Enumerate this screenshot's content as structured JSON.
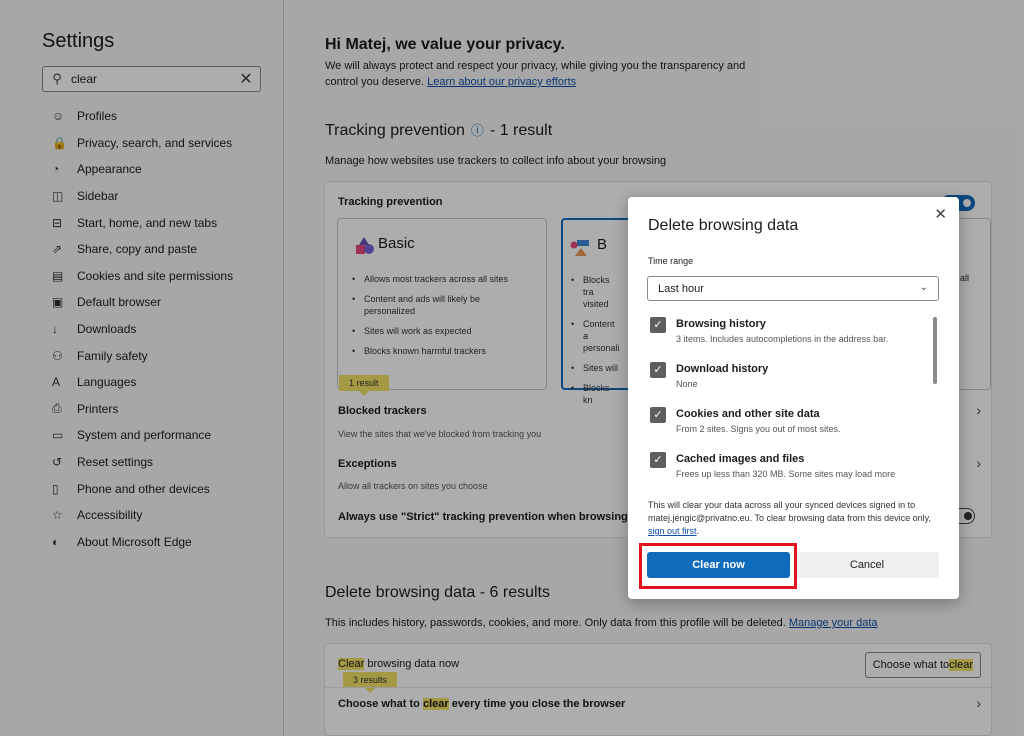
{
  "sidebar": {
    "title": "Settings",
    "search_value": "clear",
    "items": [
      {
        "label": "Profiles",
        "icon": "profile-icon",
        "glyph": "☺"
      },
      {
        "label": "Privacy, search, and services",
        "icon": "lock-icon",
        "glyph": "🔒"
      },
      {
        "label": "Appearance",
        "icon": "palette-icon",
        "glyph": "◔"
      },
      {
        "label": "Sidebar",
        "icon": "sidebar-icon",
        "glyph": "◫"
      },
      {
        "label": "Start, home, and new tabs",
        "icon": "home-tabs-icon",
        "glyph": "⊟"
      },
      {
        "label": "Share, copy and paste",
        "icon": "share-icon",
        "glyph": "⇗"
      },
      {
        "label": "Cookies and site permissions",
        "icon": "cookies-icon",
        "glyph": "▤"
      },
      {
        "label": "Default browser",
        "icon": "browser-icon",
        "glyph": "▣"
      },
      {
        "label": "Downloads",
        "icon": "download-icon",
        "glyph": "↓"
      },
      {
        "label": "Family safety",
        "icon": "family-icon",
        "glyph": "⚇"
      },
      {
        "label": "Languages",
        "icon": "languages-icon",
        "glyph": "A"
      },
      {
        "label": "Printers",
        "icon": "printer-icon",
        "glyph": "⎙"
      },
      {
        "label": "System and performance",
        "icon": "system-icon",
        "glyph": "▭"
      },
      {
        "label": "Reset settings",
        "icon": "reset-icon",
        "glyph": "↺"
      },
      {
        "label": "Phone and other devices",
        "icon": "phone-icon",
        "glyph": "▯"
      },
      {
        "label": "Accessibility",
        "icon": "accessibility-icon",
        "glyph": "☆"
      },
      {
        "label": "About Microsoft Edge",
        "icon": "edge-icon",
        "glyph": "◐"
      }
    ]
  },
  "privacy": {
    "title": "Hi Matej, we value your privacy.",
    "text": "We will always protect and respect your privacy, while giving you the transparency and control you deserve.",
    "link": "Learn about our privacy efforts"
  },
  "tracking": {
    "title": "Tracking prevention",
    "result": "- 1 result",
    "subtitle": "Manage how websites use trackers to collect info about your browsing",
    "label": "Tracking prevention",
    "basic": {
      "title": "Basic",
      "bullets": [
        "Allows most trackers across all sites",
        "Content and ads will likely be personalized",
        "Sites will work as expected",
        "Blocks known harmful trackers"
      ]
    },
    "balanced": {
      "title": "B",
      "small": "(",
      "bullets": [
        "Blocks tra visited",
        "Content a personali",
        "Sites will",
        "Blocks kn"
      ]
    },
    "strict_fragment": "all",
    "badge": "1 result",
    "blocked_title": "Blocked trackers",
    "blocked_sub": "View the sites that we've blocked from tracking you",
    "exceptions_title": "Exceptions",
    "exceptions_sub": "Allow all trackers on sites you choose",
    "strict_label": "Always use \"Strict\" tracking prevention when browsing"
  },
  "delete_section": {
    "title": "Delete browsing data - 6 results",
    "subtitle": "This includes history, passwords, cookies, and more. Only data from this profile will be deleted.",
    "link": "Manage your data",
    "row1_hl": "Clear",
    "row1_rest": " browsing data now",
    "row1_button_prefix": "Choose what to ",
    "row1_button_hl": "clear",
    "badge": "3 results",
    "row2_prefix": "Choose what to ",
    "row2_hl": "clear",
    "row2_suffix": " every time you close the browser"
  },
  "dialog": {
    "title": "Delete browsing data",
    "time_range_label": "Time range",
    "time_range_value": "Last hour",
    "items": [
      {
        "label": "Browsing history",
        "desc": "3 items. Includes autocompletions in the address bar.",
        "checked": true
      },
      {
        "label": "Download history",
        "desc": "None",
        "checked": true
      },
      {
        "label": "Cookies and other site data",
        "desc": "From 2 sites. Signs you out of most sites.",
        "checked": true
      },
      {
        "label": "Cached images and files",
        "desc": "Frees up less than 320 MB. Some sites may load more",
        "checked": true
      }
    ],
    "note": "This will clear your data across all your synced devices signed in to matej.jengic@privatno.eu. To clear browsing data from this device only,",
    "note_link": "sign out first",
    "note_end": ".",
    "clear_button": "Clear now",
    "cancel_button": "Cancel"
  },
  "colors": {
    "accent": "#0f6cbd",
    "highlight": "#f2e266",
    "annotation": "#e3141f"
  }
}
